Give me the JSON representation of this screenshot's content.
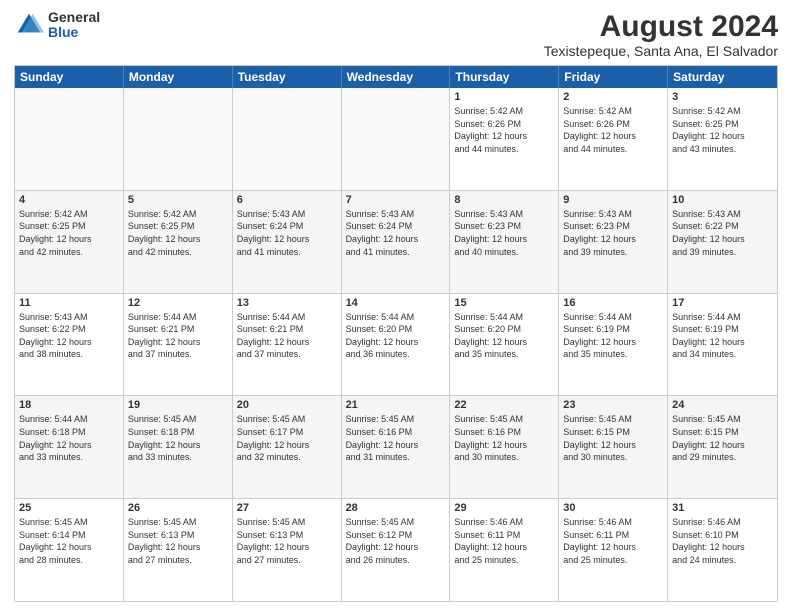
{
  "logo": {
    "general": "General",
    "blue": "Blue"
  },
  "title": "August 2024",
  "subtitle": "Texistepeque, Santa Ana, El Salvador",
  "days": [
    "Sunday",
    "Monday",
    "Tuesday",
    "Wednesday",
    "Thursday",
    "Friday",
    "Saturday"
  ],
  "weeks": [
    [
      {
        "day": "",
        "info": ""
      },
      {
        "day": "",
        "info": ""
      },
      {
        "day": "",
        "info": ""
      },
      {
        "day": "",
        "info": ""
      },
      {
        "day": "1",
        "info": "Sunrise: 5:42 AM\nSunset: 6:26 PM\nDaylight: 12 hours\nand 44 minutes."
      },
      {
        "day": "2",
        "info": "Sunrise: 5:42 AM\nSunset: 6:26 PM\nDaylight: 12 hours\nand 44 minutes."
      },
      {
        "day": "3",
        "info": "Sunrise: 5:42 AM\nSunset: 6:25 PM\nDaylight: 12 hours\nand 43 minutes."
      }
    ],
    [
      {
        "day": "4",
        "info": "Sunrise: 5:42 AM\nSunset: 6:25 PM\nDaylight: 12 hours\nand 42 minutes."
      },
      {
        "day": "5",
        "info": "Sunrise: 5:42 AM\nSunset: 6:25 PM\nDaylight: 12 hours\nand 42 minutes."
      },
      {
        "day": "6",
        "info": "Sunrise: 5:43 AM\nSunset: 6:24 PM\nDaylight: 12 hours\nand 41 minutes."
      },
      {
        "day": "7",
        "info": "Sunrise: 5:43 AM\nSunset: 6:24 PM\nDaylight: 12 hours\nand 41 minutes."
      },
      {
        "day": "8",
        "info": "Sunrise: 5:43 AM\nSunset: 6:23 PM\nDaylight: 12 hours\nand 40 minutes."
      },
      {
        "day": "9",
        "info": "Sunrise: 5:43 AM\nSunset: 6:23 PM\nDaylight: 12 hours\nand 39 minutes."
      },
      {
        "day": "10",
        "info": "Sunrise: 5:43 AM\nSunset: 6:22 PM\nDaylight: 12 hours\nand 39 minutes."
      }
    ],
    [
      {
        "day": "11",
        "info": "Sunrise: 5:43 AM\nSunset: 6:22 PM\nDaylight: 12 hours\nand 38 minutes."
      },
      {
        "day": "12",
        "info": "Sunrise: 5:44 AM\nSunset: 6:21 PM\nDaylight: 12 hours\nand 37 minutes."
      },
      {
        "day": "13",
        "info": "Sunrise: 5:44 AM\nSunset: 6:21 PM\nDaylight: 12 hours\nand 37 minutes."
      },
      {
        "day": "14",
        "info": "Sunrise: 5:44 AM\nSunset: 6:20 PM\nDaylight: 12 hours\nand 36 minutes."
      },
      {
        "day": "15",
        "info": "Sunrise: 5:44 AM\nSunset: 6:20 PM\nDaylight: 12 hours\nand 35 minutes."
      },
      {
        "day": "16",
        "info": "Sunrise: 5:44 AM\nSunset: 6:19 PM\nDaylight: 12 hours\nand 35 minutes."
      },
      {
        "day": "17",
        "info": "Sunrise: 5:44 AM\nSunset: 6:19 PM\nDaylight: 12 hours\nand 34 minutes."
      }
    ],
    [
      {
        "day": "18",
        "info": "Sunrise: 5:44 AM\nSunset: 6:18 PM\nDaylight: 12 hours\nand 33 minutes."
      },
      {
        "day": "19",
        "info": "Sunrise: 5:45 AM\nSunset: 6:18 PM\nDaylight: 12 hours\nand 33 minutes."
      },
      {
        "day": "20",
        "info": "Sunrise: 5:45 AM\nSunset: 6:17 PM\nDaylight: 12 hours\nand 32 minutes."
      },
      {
        "day": "21",
        "info": "Sunrise: 5:45 AM\nSunset: 6:16 PM\nDaylight: 12 hours\nand 31 minutes."
      },
      {
        "day": "22",
        "info": "Sunrise: 5:45 AM\nSunset: 6:16 PM\nDaylight: 12 hours\nand 30 minutes."
      },
      {
        "day": "23",
        "info": "Sunrise: 5:45 AM\nSunset: 6:15 PM\nDaylight: 12 hours\nand 30 minutes."
      },
      {
        "day": "24",
        "info": "Sunrise: 5:45 AM\nSunset: 6:15 PM\nDaylight: 12 hours\nand 29 minutes."
      }
    ],
    [
      {
        "day": "25",
        "info": "Sunrise: 5:45 AM\nSunset: 6:14 PM\nDaylight: 12 hours\nand 28 minutes."
      },
      {
        "day": "26",
        "info": "Sunrise: 5:45 AM\nSunset: 6:13 PM\nDaylight: 12 hours\nand 27 minutes."
      },
      {
        "day": "27",
        "info": "Sunrise: 5:45 AM\nSunset: 6:13 PM\nDaylight: 12 hours\nand 27 minutes."
      },
      {
        "day": "28",
        "info": "Sunrise: 5:45 AM\nSunset: 6:12 PM\nDaylight: 12 hours\nand 26 minutes."
      },
      {
        "day": "29",
        "info": "Sunrise: 5:46 AM\nSunset: 6:11 PM\nDaylight: 12 hours\nand 25 minutes."
      },
      {
        "day": "30",
        "info": "Sunrise: 5:46 AM\nSunset: 6:11 PM\nDaylight: 12 hours\nand 25 minutes."
      },
      {
        "day": "31",
        "info": "Sunrise: 5:46 AM\nSunset: 6:10 PM\nDaylight: 12 hours\nand 24 minutes."
      }
    ]
  ]
}
